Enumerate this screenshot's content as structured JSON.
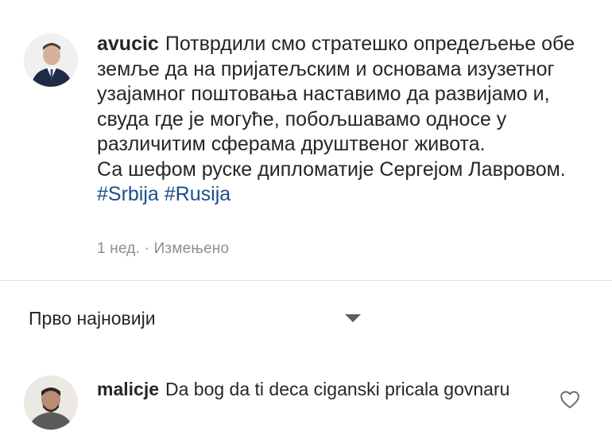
{
  "post": {
    "username": "avucic",
    "caption_text": "Потврдили смо стратешко опредељење обе земље да на пријатељским и основама изузетног узајамног поштовања наставимо да развијамо и, свуда где је могуће, побољшавамо односе у различитим сферама друштвеног живота.",
    "caption_line2": "Са шефом руске дипломатије Сергејом Лавровом.",
    "hashtags": [
      "#Srbija",
      "#Rusija"
    ],
    "time": "1 нед.",
    "separator": "·",
    "edited": "Измењено"
  },
  "sort": {
    "label": "Прво најновији"
  },
  "comment": {
    "username": "malicje",
    "text": "Da bog da ti deca ciganski pricala govnaru"
  },
  "icons": {
    "sort_chevron": "chevron-down-icon",
    "like": "heart-icon"
  }
}
